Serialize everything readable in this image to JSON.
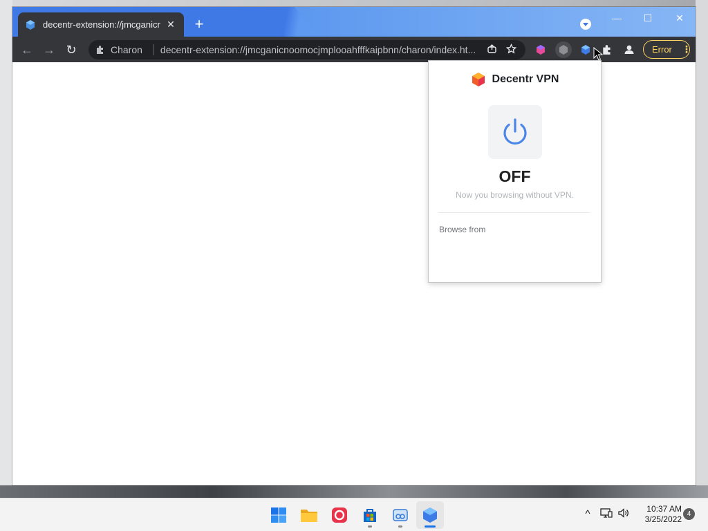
{
  "browser": {
    "tab": {
      "title": "decentr-extension://jmcganicnoomocjmplooahfffkaipbnn/charon/index.html",
      "close": "✕"
    },
    "new_tab": "+",
    "window_controls": {
      "minimize": "—",
      "maximize": "☐",
      "close": "✕"
    },
    "toolbar": {
      "back": "←",
      "forward": "→",
      "reload": "↻",
      "omnibox": {
        "extension_name": "Charon",
        "url": "decentr-extension://jmcganicnoomocjmplooahfffkaipbnn/charon/index.ht..."
      },
      "extensions": [
        "decentr-extension-icon",
        "grey-extension-icon",
        "decentr-vpn-extension-icon",
        "puzzle-icon",
        "profile-icon"
      ],
      "error_chip": {
        "label": "Error",
        "menu": "⋮"
      }
    }
  },
  "popup": {
    "title": "Decentr VPN",
    "status": "OFF",
    "status_message": "Now you browsing without VPN.",
    "browse_from_label": "Browse from"
  },
  "taskbar": {
    "apps": [
      "windows-start-icon",
      "file-explorer-icon",
      "creative-cloud-icon",
      "microsoft-store-icon",
      "snipping-icon",
      "decentr-browser-icon"
    ],
    "tray": {
      "chevron": "^",
      "network": "🖵",
      "volume": "🔊"
    },
    "clock": {
      "time": "10:37 AM",
      "date": "3/25/2022"
    },
    "notifications": "4"
  },
  "colors": {
    "titlebar": "#3f79e6",
    "toolbar": "#35363a",
    "error_accent": "#fdd663",
    "power_blue": "#4a86e8"
  }
}
